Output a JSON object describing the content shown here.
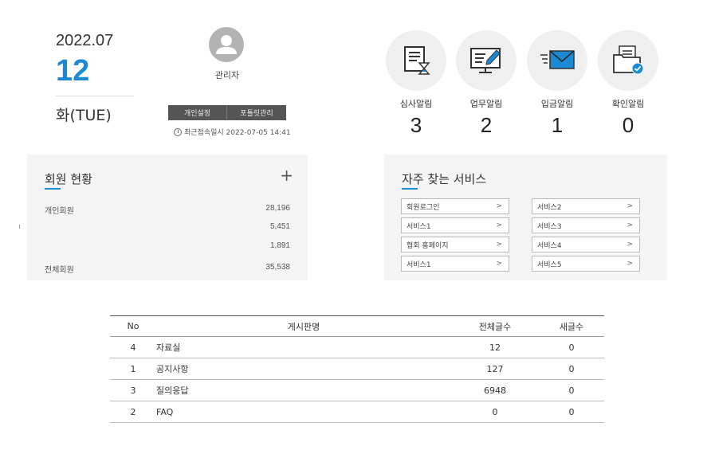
{
  "date": {
    "year_month": "2022.07",
    "day": "12",
    "weekday": "화(TUE)"
  },
  "admin": {
    "name": "관리자",
    "buttons": [
      "개인설정",
      "포틀릿관리"
    ],
    "last_login": "최근접속일시 2022-07-05 14:41"
  },
  "alerts": [
    {
      "label": "심사알림",
      "count": "3",
      "icon": "document-hourglass-icon"
    },
    {
      "label": "업무알림",
      "count": "2",
      "icon": "monitor-pen-icon"
    },
    {
      "label": "입금알림",
      "count": "1",
      "icon": "envelope-icon"
    },
    {
      "label": "확인알림",
      "count": "0",
      "icon": "folder-check-icon"
    }
  ],
  "members": {
    "title": "회원 현황",
    "add_label": "+",
    "rows": [
      {
        "label": "개인회원",
        "value": "28,196"
      },
      {
        "label": "",
        "value": "5,451"
      },
      {
        "label": "",
        "value": "1,891"
      },
      {
        "label": "전체회원",
        "value": "35,538"
      }
    ]
  },
  "services": {
    "title": "자주 찾는 서비스",
    "chevron": ">",
    "left": [
      "회원로그인",
      "서비스1",
      "협회 홈페이지",
      "서비스1"
    ],
    "right": [
      "서비스2",
      "서비스3",
      "서비스4",
      "서비스5"
    ]
  },
  "board": {
    "headers": {
      "no": "No",
      "name": "게시판명",
      "total": "전체글수",
      "new": "새글수"
    },
    "rows": [
      {
        "no": "4",
        "name": "자료실",
        "total": "12",
        "new": "0"
      },
      {
        "no": "1",
        "name": "공지사항",
        "total": "127",
        "new": "0"
      },
      {
        "no": "3",
        "name": "질의응답",
        "total": "6948",
        "new": "0"
      },
      {
        "no": "2",
        "name": "FAQ",
        "total": "0",
        "new": "0"
      }
    ]
  },
  "colors": {
    "accent": "#1a8ad4",
    "panel_bg": "#f5f5f5",
    "alert_circle": "#efefef"
  }
}
